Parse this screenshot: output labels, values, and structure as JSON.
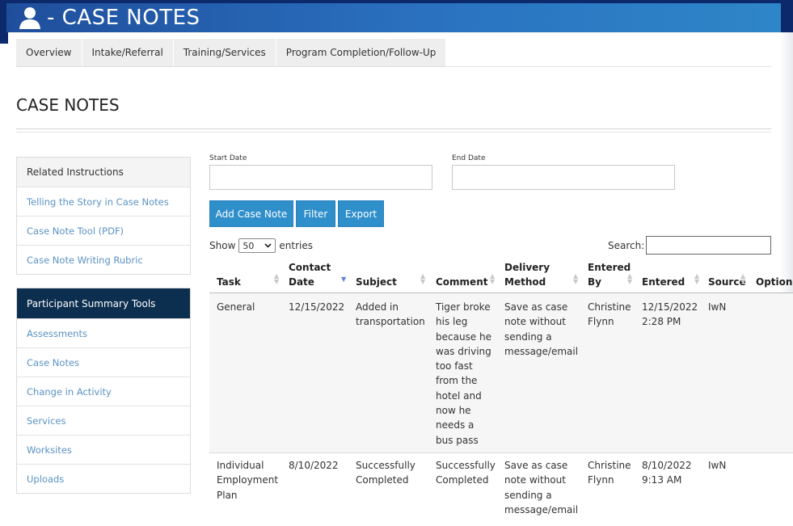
{
  "header": {
    "title": "- CASE NOTES",
    "icon": "user-icon"
  },
  "tabs": [
    "Overview",
    "Intake/Referral",
    "Training/Services",
    "Program Completion/Follow-Up"
  ],
  "page_title": "CASE NOTES",
  "related_instructions": {
    "heading": "Related Instructions",
    "links": [
      "Telling the Story in Case Notes",
      "Case Note Tool (PDF)",
      "Case Note Writing Rubric"
    ]
  },
  "summary_tools": {
    "heading": "Participant Summary Tools",
    "links": [
      "Assessments",
      "Case Notes",
      "Change in Activity",
      "Services",
      "Worksites",
      "Uploads"
    ]
  },
  "filters": {
    "start_label": "Start Date",
    "start_value": "",
    "end_label": "End Date",
    "end_value": "",
    "buttons": {
      "add": "Add Case Note",
      "filter": "Filter",
      "export": "Export"
    }
  },
  "table_controls": {
    "show": "Show",
    "entries_value": "50",
    "entries": "entries",
    "search_label": "Search:",
    "search_value": ""
  },
  "table": {
    "headers": {
      "task": "Task",
      "contact_date": "Contact Date",
      "subject": "Subject",
      "comment": "Comment",
      "delivery_method": "Delivery Method",
      "entered_by": "Entered By",
      "entered": "Entered",
      "source": "Source",
      "options": "Options"
    },
    "rows": [
      {
        "task": "General",
        "contact_date": "12/15/2022",
        "subject": "Added in transportation",
        "comment": "Tiger broke his leg because he was driving too fast from the hotel and now he needs a bus pass",
        "delivery_method": "Save as case note without sending a message/email",
        "entered_by": "Christine Flynn",
        "entered": "12/15/2022 2:28 PM",
        "source": "IwN"
      },
      {
        "task": "Individual Employment Plan",
        "contact_date": "8/10/2022",
        "subject": "Successfully Completed",
        "comment": "Successfully Completed",
        "delivery_method": "Save as case note without sending a message/email",
        "entered_by": "Christine Flynn",
        "entered": "8/10/2022 9:13 AM",
        "source": "IwN"
      }
    ]
  },
  "colors": {
    "banner": "#1f4e9c",
    "button": "#2f8fcb",
    "link": "#5a92c4",
    "panel_dark": "#0d2f4f"
  }
}
